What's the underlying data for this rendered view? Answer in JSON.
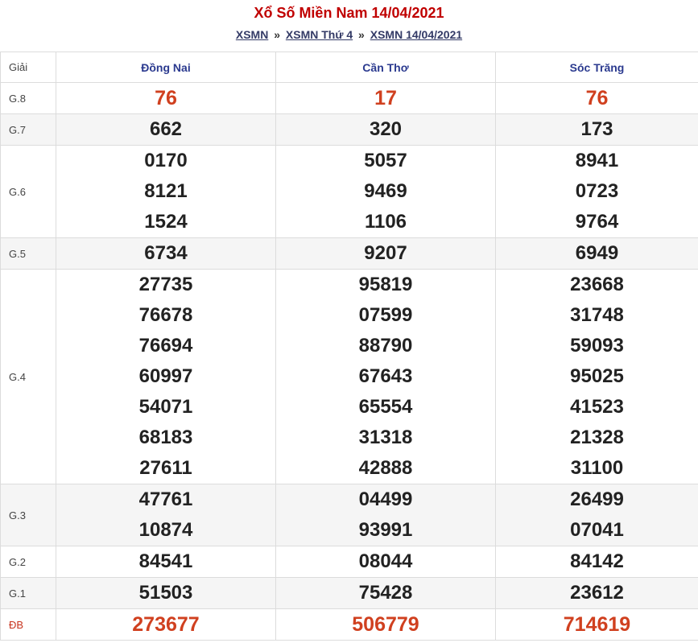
{
  "header": {
    "title": "Xổ Số Miền Nam 14/04/2021",
    "breadcrumb": [
      {
        "label": "XSMN"
      },
      {
        "label": "XSMN Thứ 4"
      },
      {
        "label": "XSMN 14/04/2021"
      }
    ],
    "separator": "»"
  },
  "table": {
    "giai_header": "Giải",
    "provinces": [
      "Đồng Nai",
      "Cần Thơ",
      "Sóc Trăng"
    ],
    "rows": [
      {
        "label": "G.8",
        "red": true,
        "alt": false,
        "values": [
          [
            "76"
          ],
          [
            "17"
          ],
          [
            "76"
          ]
        ]
      },
      {
        "label": "G.7",
        "red": false,
        "alt": true,
        "values": [
          [
            "662"
          ],
          [
            "320"
          ],
          [
            "173"
          ]
        ]
      },
      {
        "label": "G.6",
        "red": false,
        "alt": false,
        "values": [
          [
            "0170",
            "8121",
            "1524"
          ],
          [
            "5057",
            "9469",
            "1106"
          ],
          [
            "8941",
            "0723",
            "9764"
          ]
        ]
      },
      {
        "label": "G.5",
        "red": false,
        "alt": true,
        "values": [
          [
            "6734"
          ],
          [
            "9207"
          ],
          [
            "6949"
          ]
        ]
      },
      {
        "label": "G.4",
        "red": false,
        "alt": false,
        "values": [
          [
            "27735",
            "76678",
            "76694",
            "60997",
            "54071",
            "68183",
            "27611"
          ],
          [
            "95819",
            "07599",
            "88790",
            "67643",
            "65554",
            "31318",
            "42888"
          ],
          [
            "23668",
            "31748",
            "59093",
            "95025",
            "41523",
            "21328",
            "31100"
          ]
        ]
      },
      {
        "label": "G.3",
        "red": false,
        "alt": true,
        "values": [
          [
            "47761",
            "10874"
          ],
          [
            "04499",
            "93991"
          ],
          [
            "26499",
            "07041"
          ]
        ]
      },
      {
        "label": "G.2",
        "red": false,
        "alt": false,
        "values": [
          [
            "84541"
          ],
          [
            "08044"
          ],
          [
            "84142"
          ]
        ]
      },
      {
        "label": "G.1",
        "red": false,
        "alt": true,
        "values": [
          [
            "51503"
          ],
          [
            "75428"
          ],
          [
            "23612"
          ]
        ]
      },
      {
        "label": "ĐB",
        "red": true,
        "alt": false,
        "db": true,
        "values": [
          [
            "273677"
          ],
          [
            "506779"
          ],
          [
            "714619"
          ]
        ]
      }
    ]
  }
}
